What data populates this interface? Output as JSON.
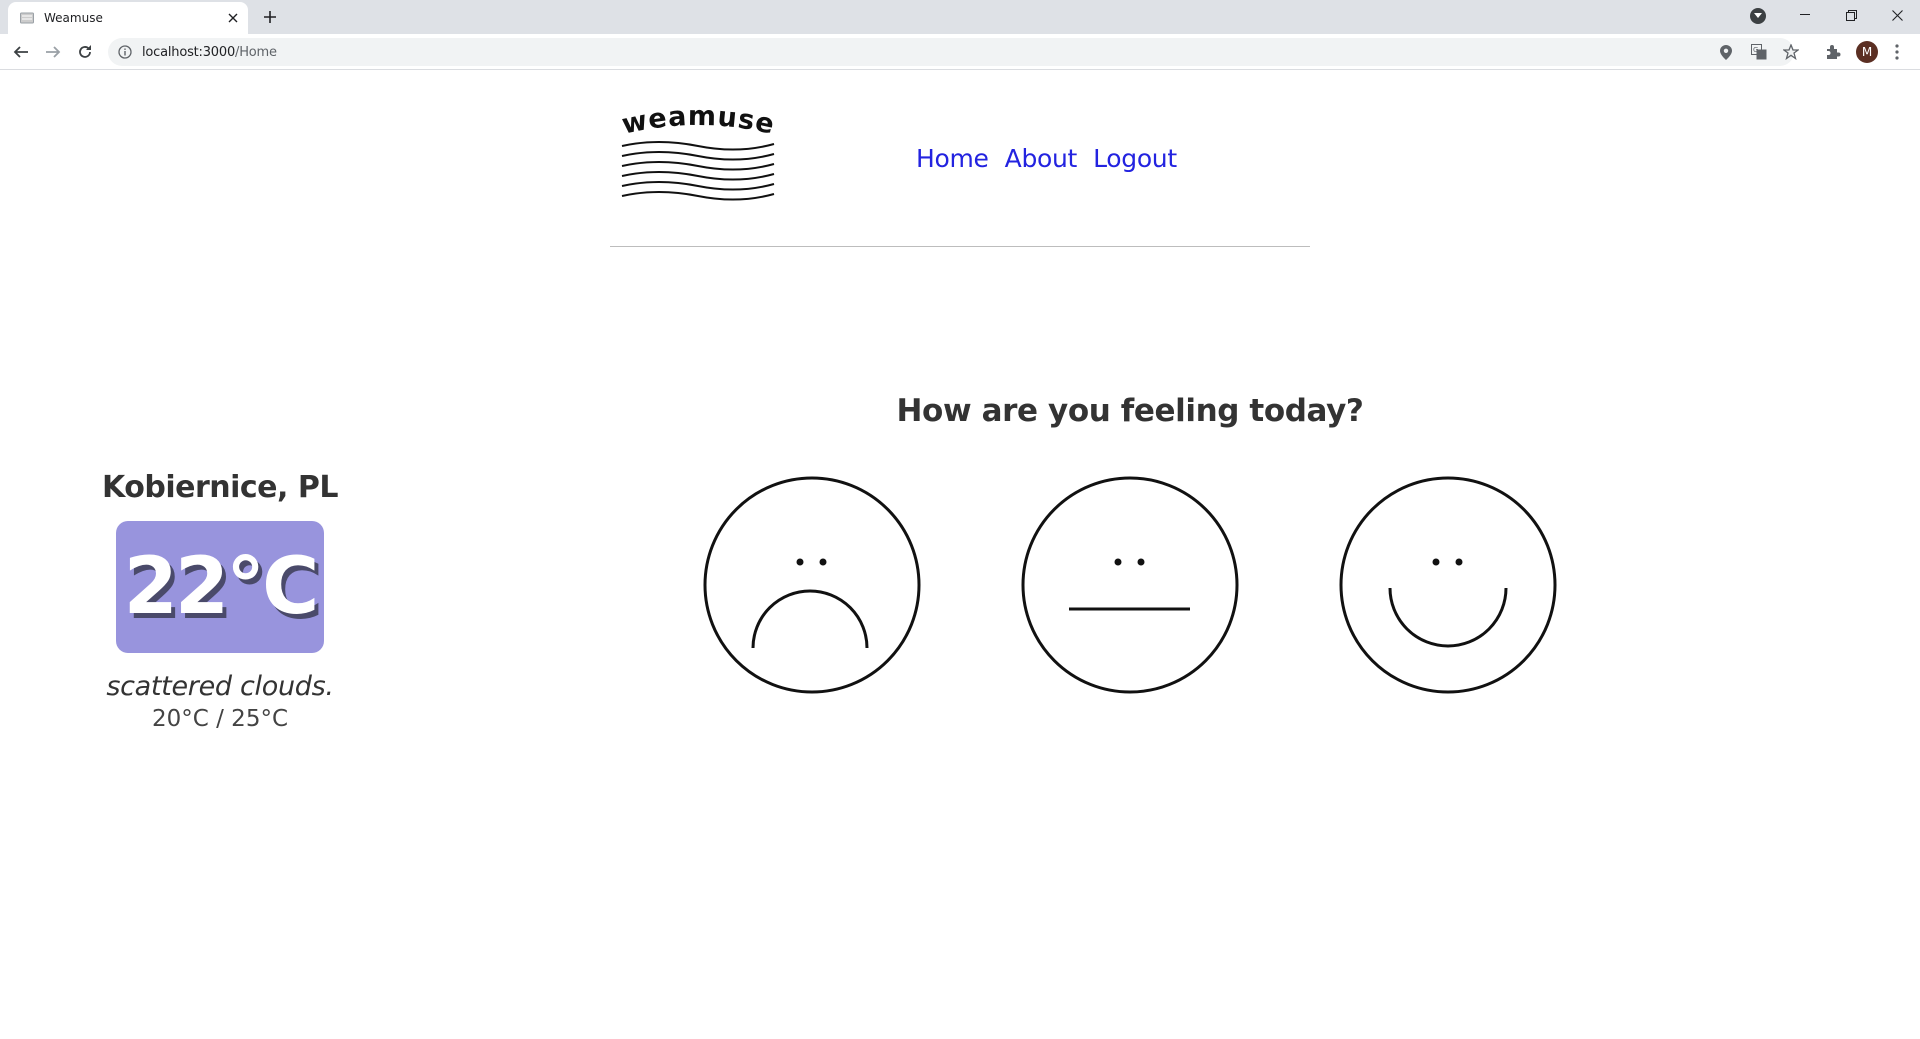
{
  "browser": {
    "tab_title": "Weamuse",
    "url_host": "localhost:3000",
    "url_path": "/Home",
    "profile_initial": "M",
    "icons": [
      "back-icon",
      "forward-icon",
      "reload-icon",
      "info-icon",
      "location-icon",
      "translate-icon",
      "star-icon",
      "extensions-icon",
      "more-icon"
    ]
  },
  "site": {
    "logo_text": "weamuse",
    "nav": {
      "home": "Home",
      "about": "About",
      "logout": "Logout"
    }
  },
  "weather": {
    "city": "Kobiernice, PL",
    "temperature": "22°C",
    "description": "scattered clouds.",
    "range": "20°C / 25°C",
    "accent_color": "#9894dd"
  },
  "mood": {
    "question": "How are you feeling today?",
    "options": [
      "sad",
      "neutral",
      "happy"
    ]
  }
}
